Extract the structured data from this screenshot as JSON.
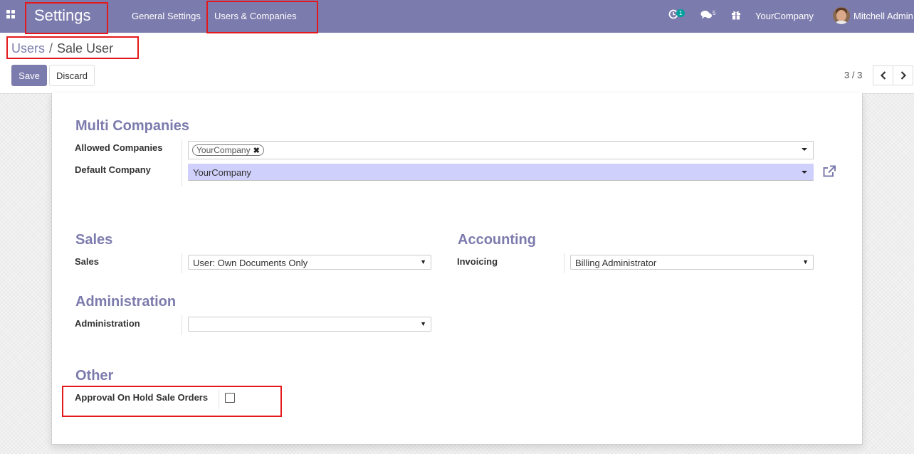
{
  "navbar": {
    "brand": "Settings",
    "menu": [
      "General Settings",
      "Users & Companies"
    ],
    "activity_count": "1",
    "messages_count": "5",
    "company": "YourCompany",
    "user": "Mitchell Admin"
  },
  "breadcrumb": {
    "parent": "Users",
    "separator": "/",
    "current": "Sale User"
  },
  "buttons": {
    "save": "Save",
    "discard": "Discard"
  },
  "pager": {
    "value": "3 / 3"
  },
  "form": {
    "multi_companies": {
      "title": "Multi Companies",
      "allowed_label": "Allowed Companies",
      "allowed_tag": "YourCompany",
      "default_label": "Default Company",
      "default_value": "YourCompany"
    },
    "sales": {
      "title": "Sales",
      "label": "Sales",
      "value": "User: Own Documents Only"
    },
    "accounting": {
      "title": "Accounting",
      "label": "Invoicing",
      "value": "Billing Administrator"
    },
    "administration": {
      "title": "Administration",
      "label": "Administration",
      "value": ""
    },
    "other": {
      "title": "Other",
      "label": "Approval On Hold Sale Orders",
      "checked": false
    }
  },
  "colors": {
    "primary": "#7c7bad",
    "annotation": "#e3191b",
    "highlight_field": "#d0d0fc"
  }
}
